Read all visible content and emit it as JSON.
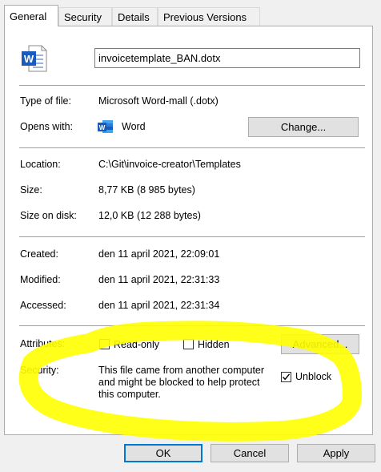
{
  "tabs": [
    {
      "label": "General"
    },
    {
      "label": "Security"
    },
    {
      "label": "Details"
    },
    {
      "label": "Previous Versions"
    }
  ],
  "file": {
    "name": "invoicetemplate_BAN.dotx",
    "icon": "word-document-icon"
  },
  "type": {
    "label": "Type of file:",
    "value": "Microsoft Word-mall (.dotx)"
  },
  "opens_with": {
    "label": "Opens with:",
    "app": "Word",
    "icon": "word-app-icon",
    "change_label": "Change..."
  },
  "location": {
    "label": "Location:",
    "value": "C:\\Git\\invoice-creator\\Templates"
  },
  "size": {
    "label": "Size:",
    "value": "8,77 KB (8 985 bytes)"
  },
  "size_on_disk": {
    "label": "Size on disk:",
    "value": "12,0 KB (12 288 bytes)"
  },
  "created": {
    "label": "Created:",
    "value": "den 11 april 2021, 22:09:01"
  },
  "modified": {
    "label": "Modified:",
    "value": "den 11 april 2021, 22:31:33"
  },
  "accessed": {
    "label": "Accessed:",
    "value": "den 11 april 2021, 22:31:34"
  },
  "attributes": {
    "label": "Attributes:",
    "readonly_label": "Read-only",
    "readonly_checked": false,
    "hidden_label": "Hidden",
    "hidden_checked": false,
    "advanced_label": "Advanced..."
  },
  "security": {
    "label": "Security:",
    "message_lines": [
      "This file came from another computer",
      "and might be blocked to help protect",
      "this computer."
    ],
    "unblock_label": "Unblock",
    "unblock_checked": true
  },
  "footer": {
    "ok_label": "OK",
    "cancel_label": "Cancel",
    "apply_label": "Apply"
  },
  "colors": {
    "highlight": "#ffff00",
    "accent": "#0078d7",
    "word_blue": "#185abd"
  }
}
